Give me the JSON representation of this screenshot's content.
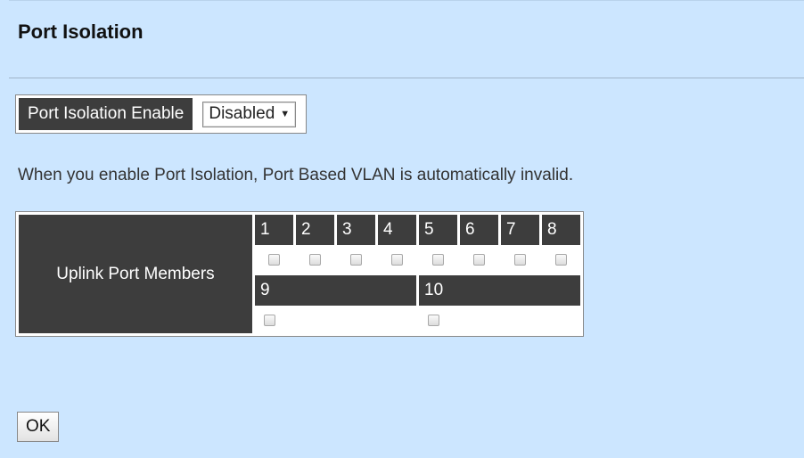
{
  "header": {
    "title": "Port Isolation"
  },
  "enable": {
    "label": "Port Isolation Enable",
    "value": "Disabled"
  },
  "note": "When you enable Port Isolation, Port Based VLAN is automatically invalid.",
  "uplink": {
    "label": "Uplink Port Members",
    "row1_ports": [
      "1",
      "2",
      "3",
      "4",
      "5",
      "6",
      "7",
      "8"
    ],
    "row2_ports": [
      "9",
      "10"
    ],
    "checked": [
      false,
      false,
      false,
      false,
      false,
      false,
      false,
      false,
      false,
      false
    ]
  },
  "actions": {
    "ok_label": "OK"
  },
  "colors": {
    "background": "#cce6ff",
    "header_cell": "#3d3d3d"
  }
}
